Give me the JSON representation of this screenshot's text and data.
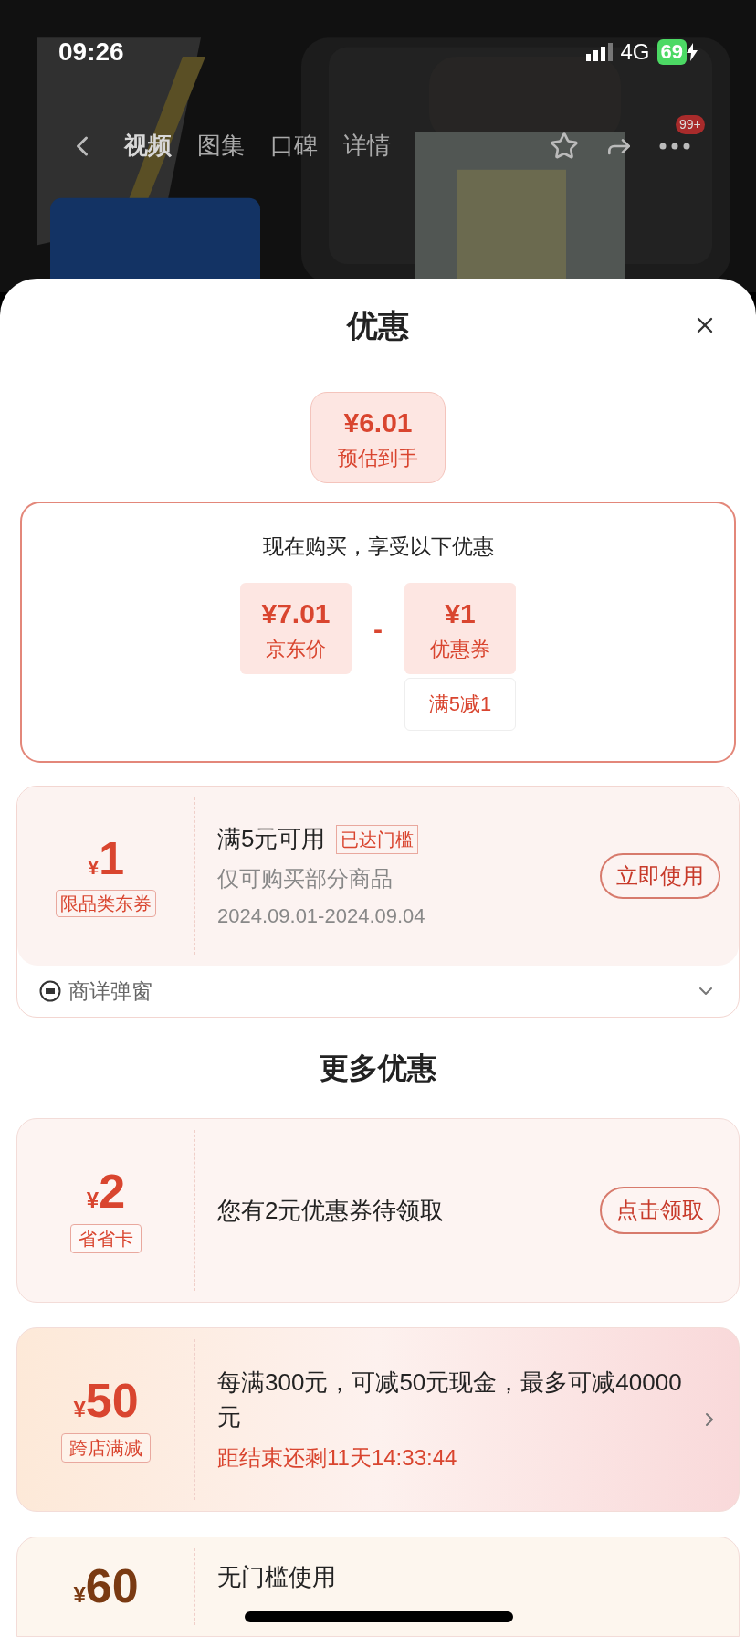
{
  "status_bar": {
    "time": "09:26",
    "network": "4G",
    "battery": "69"
  },
  "nav": {
    "tabs": [
      {
        "label": "视频",
        "selected": true
      },
      {
        "label": "图集",
        "selected": false
      },
      {
        "label": "口碑",
        "selected": false
      },
      {
        "label": "详情",
        "selected": false
      }
    ],
    "badge": "99+"
  },
  "sheet": {
    "title": "优惠",
    "estimate": {
      "price": "¥6.01",
      "label": "预估到手"
    },
    "breakdown": {
      "heading": "现在购买，享受以下优惠",
      "items": [
        {
          "price": "¥7.01",
          "label": "京东价"
        },
        {
          "price": "¥1",
          "label": "优惠券",
          "note": "满5减1"
        }
      ],
      "operator": "-"
    },
    "coupon": {
      "currency": "¥",
      "amount": "1",
      "tag": "限品类东券",
      "title": "满5元可用",
      "badge": "已达门槛",
      "desc": "仅可购买部分商品",
      "dates": "2024.09.01-2024.09.04",
      "button": "立即使用",
      "footer": "商详弹窗"
    },
    "more_title": "更多优惠",
    "offers": [
      {
        "kind": "button",
        "currency": "¥",
        "amount": "2",
        "tag": "省省卡",
        "text": "您有2元优惠券待领取",
        "button": "点击领取"
      },
      {
        "kind": "arrow",
        "currency": "¥",
        "amount": "50",
        "tag": "跨店满减",
        "text": "每满300元，可减50元现金，最多可减40000元",
        "countdown": "距结束还剩11天14:33:44"
      },
      {
        "kind": "plain",
        "currency": "¥",
        "amount": "60",
        "text": "无门槛使用"
      }
    ]
  }
}
